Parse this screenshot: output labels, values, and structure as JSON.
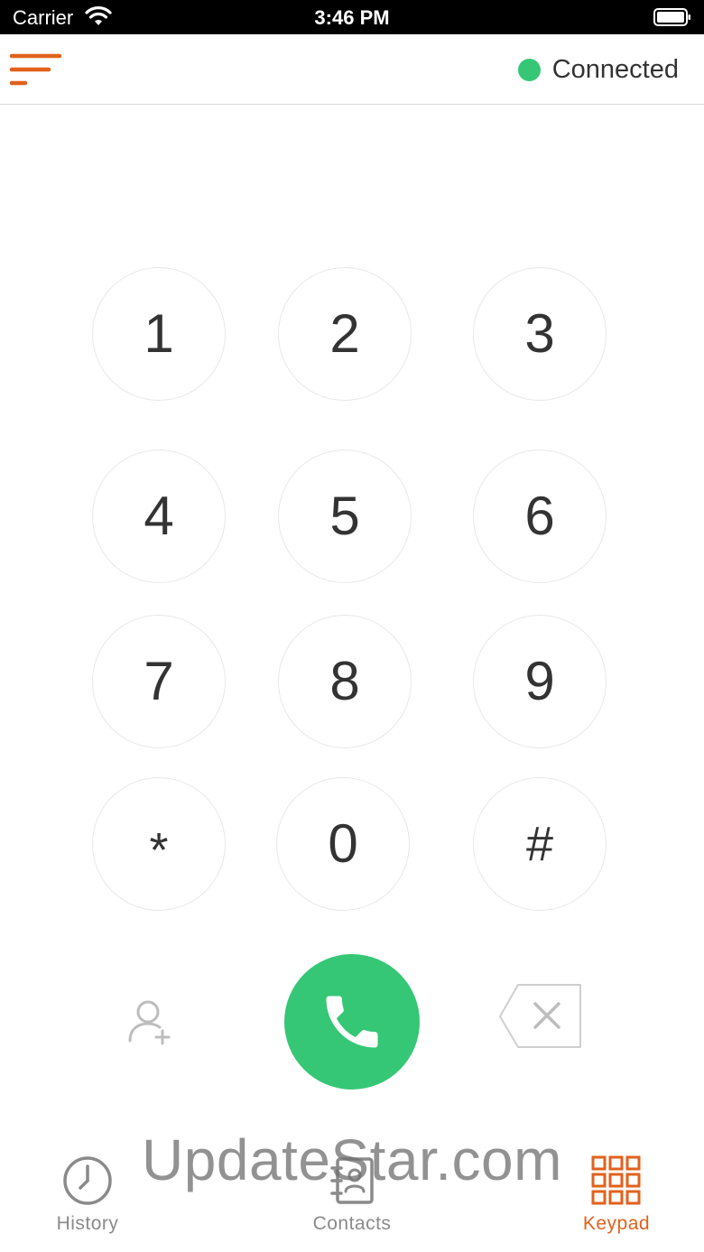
{
  "status_bar": {
    "carrier": "Carrier",
    "time": "3:46 PM"
  },
  "header": {
    "menu_icon": "hamburger-menu-icon",
    "status_label": "Connected",
    "status_color": "#35c775",
    "accent_color": "#e2611c"
  },
  "keypad": {
    "keys": [
      "1",
      "2",
      "3",
      "4",
      "5",
      "6",
      "7",
      "8",
      "9",
      "*",
      "0",
      "#"
    ]
  },
  "actions": {
    "add_contact_icon": "add-contact-icon",
    "call_icon": "phone-icon",
    "call_color": "#35c775",
    "backspace_icon": "backspace-icon"
  },
  "tabs": [
    {
      "label": "History",
      "icon": "clock-icon",
      "active": false
    },
    {
      "label": "Contacts",
      "icon": "address-book-icon",
      "active": false
    },
    {
      "label": "Keypad",
      "icon": "keypad-grid-icon",
      "active": true
    }
  ],
  "watermark": "UpdateStar.com"
}
